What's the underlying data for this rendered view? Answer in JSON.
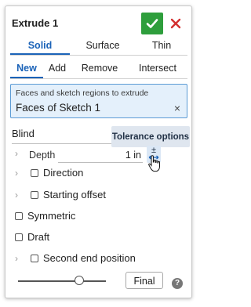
{
  "dialog": {
    "title": "Extrude 1"
  },
  "colors": {
    "accent": "#1b63b8",
    "confirm": "#2e9e3c",
    "cancel": "#d32f2f",
    "selection_bg": "#e4f0fb"
  },
  "type_tabs": [
    {
      "label": "Solid",
      "active": true
    },
    {
      "label": "Surface",
      "active": false
    },
    {
      "label": "Thin",
      "active": false
    }
  ],
  "operation_tabs": [
    {
      "label": "New",
      "active": true
    },
    {
      "label": "Add",
      "active": false
    },
    {
      "label": "Remove",
      "active": false
    },
    {
      "label": "Intersect",
      "active": false
    }
  ],
  "selection": {
    "label": "Faces and sketch regions to extrude",
    "value": "Faces of Sketch 1",
    "clear_icon": "×"
  },
  "end_type": {
    "value": "Blind"
  },
  "tooltip": {
    "text": "Tolerance options"
  },
  "depth": {
    "label": "Depth",
    "value": "1 in",
    "tolerance_symbol": "±"
  },
  "options": {
    "direction": "Direction",
    "starting_offset": "Starting offset",
    "symmetric": "Symmetric",
    "draft": "Draft",
    "second_end": "Second end position"
  },
  "footer": {
    "final_label": "Final",
    "help_label": "?"
  }
}
